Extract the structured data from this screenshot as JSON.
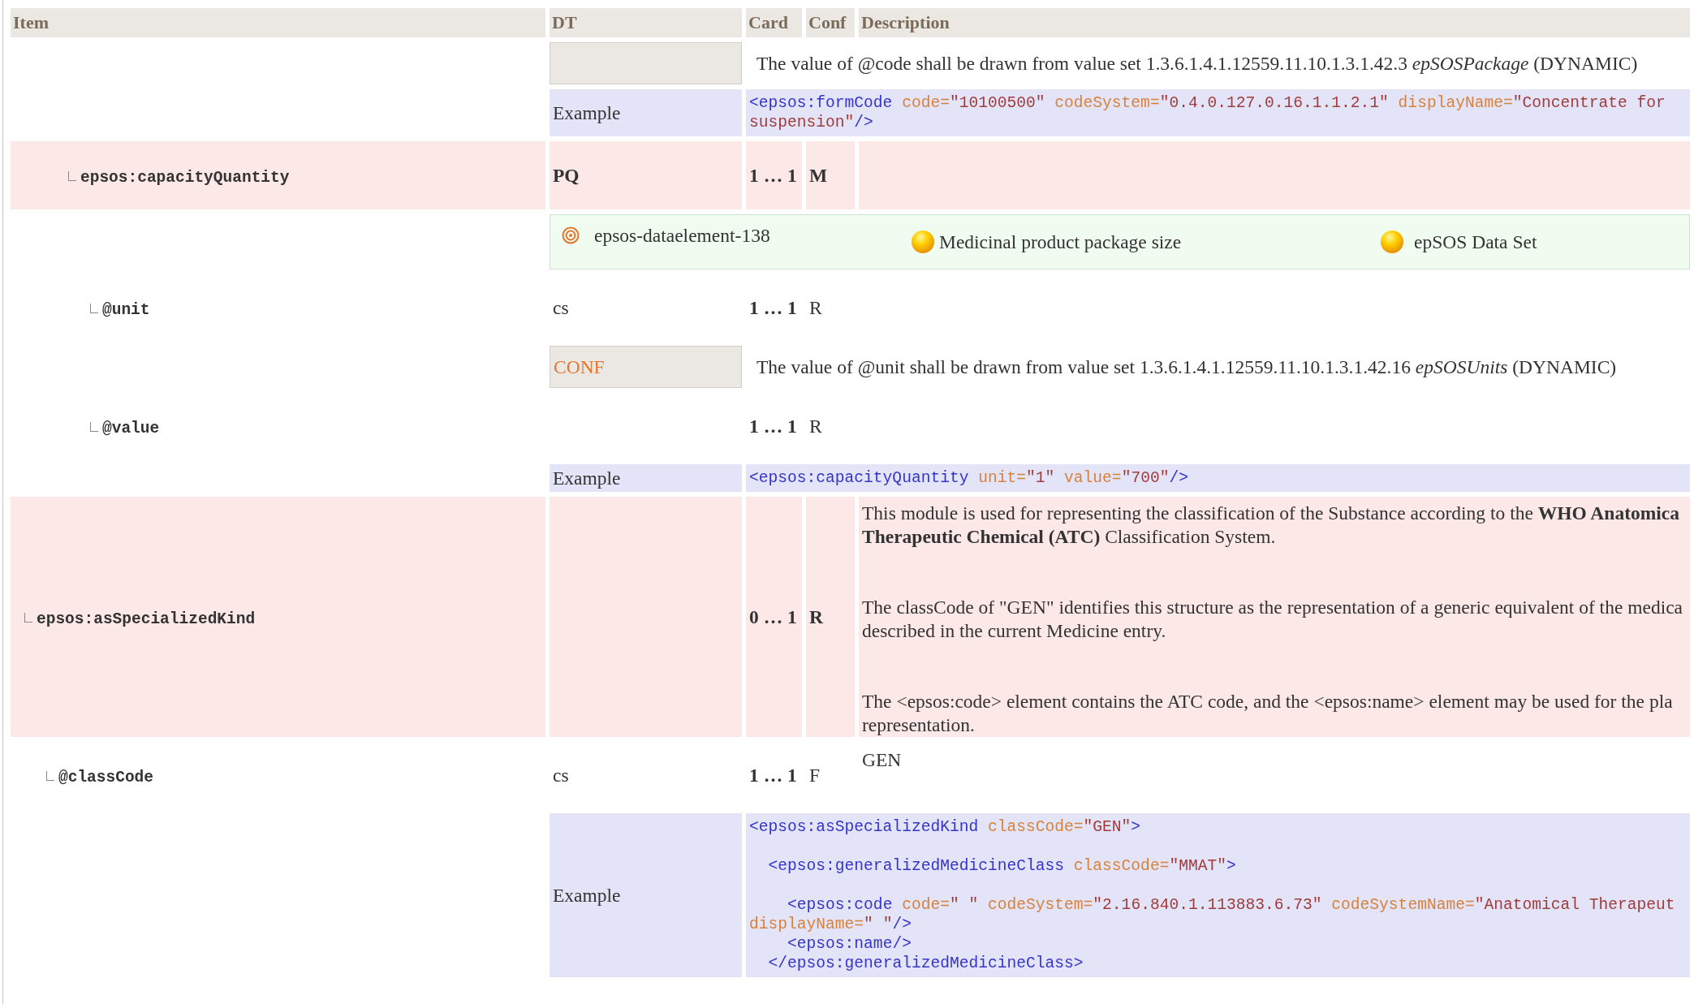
{
  "columns": [
    "Item",
    "DT",
    "Card",
    "Conf",
    "Description"
  ],
  "tree": [
    {
      "children": [
        {
          "children": [
            {
              "details": [
                {
                  "kind": "constraint",
                  "desc": "The value of @code shall be drawn from value set 1.3.6.1.4.1.12559.11.10.1.3.1.42.3 *epSOSPackage* (DYNAMIC)"
                }
              ],
              "examples": [
                {
                  "label": "Example",
                  "code": "<epsos:formCode code=\"10100500\" codeSystem=\"0.4.0.127.0.16.1.1.2.1\" displayName=\"Concentrate for\nsuspension\"/>"
                }
              ]
            },
            {
              "kind": "element",
              "item": "epsos:capacityQuantity",
              "dt": "PQ",
              "card": "1 … 1",
              "conf": "M",
              "details": [
                {
                  "kind": "concept",
                  "concepts": [
                    {
                      "kind": "dataelement",
                      "label": "epsos-dataelement-138"
                    },
                    {
                      "kind": "dataset",
                      "label": "Medicinal product package size"
                    },
                    {
                      "kind": "dataset",
                      "label": "epSOS Data Set"
                    }
                  ]
                }
              ],
              "children": [
                {
                  "kind": "attribute",
                  "item": "@unit",
                  "dt": "cs",
                  "card": "1 … 1",
                  "conf": "R",
                  "details": [
                    {
                      "kind": "constraint",
                      "label": "CONF",
                      "desc": "The value of @unit shall be drawn from value set 1.3.6.1.4.1.12559.11.10.1.3.1.42.16 *epSOSUnits* (DYNAMIC)"
                    }
                  ]
                },
                {
                  "kind": "attribute",
                  "item": "@value",
                  "card": "1 … 1",
                  "conf": "R"
                }
              ],
              "examples": [
                {
                  "label": "Example",
                  "code": "<epsos:capacityQuantity unit=\"1\" value=\"700\"/>"
                }
              ]
            }
          ]
        }
      ]
    },
    {
      "kind": "element",
      "item": "epsos:asSpecializedKind",
      "card": "0 … 1",
      "conf": "R",
      "desc": [
        [
          "This module is used for representing the classification of the Substance according to the **WHO Anatomica**",
          "**Therapeutic Chemical (ATC)** Classification System."
        ],
        [
          "The classCode of \"GEN\" identifies this structure as the representation of a generic equivalent of the medica",
          "described in the current Medicine entry."
        ],
        [
          "The <epsos:code> element contains the ATC code, and the <epsos:name> element may be used for the pla",
          "representation."
        ]
      ],
      "children": [
        {
          "kind": "attribute",
          "item": "@classCode",
          "dt": "cs",
          "card": "1 … 1",
          "conf": "F",
          "desc": [
            [
              "GEN"
            ]
          ]
        }
      ],
      "examples": [
        {
          "label": "Example",
          "code": "<epsos:asSpecializedKind classCode=\"GEN\">\n\n  <epsos:generalizedMedicineClass classCode=\"MMAT\">\n\n    <epsos:code code=\" \" codeSystem=\"2.16.840.1.113883.6.73\" codeSystemName=\"Anatomical Therapeut\ndisplayName=\" \"/>\n    <epsos:name/>\n  </epsos:generalizedMedicineClass>"
        }
      ]
    }
  ]
}
